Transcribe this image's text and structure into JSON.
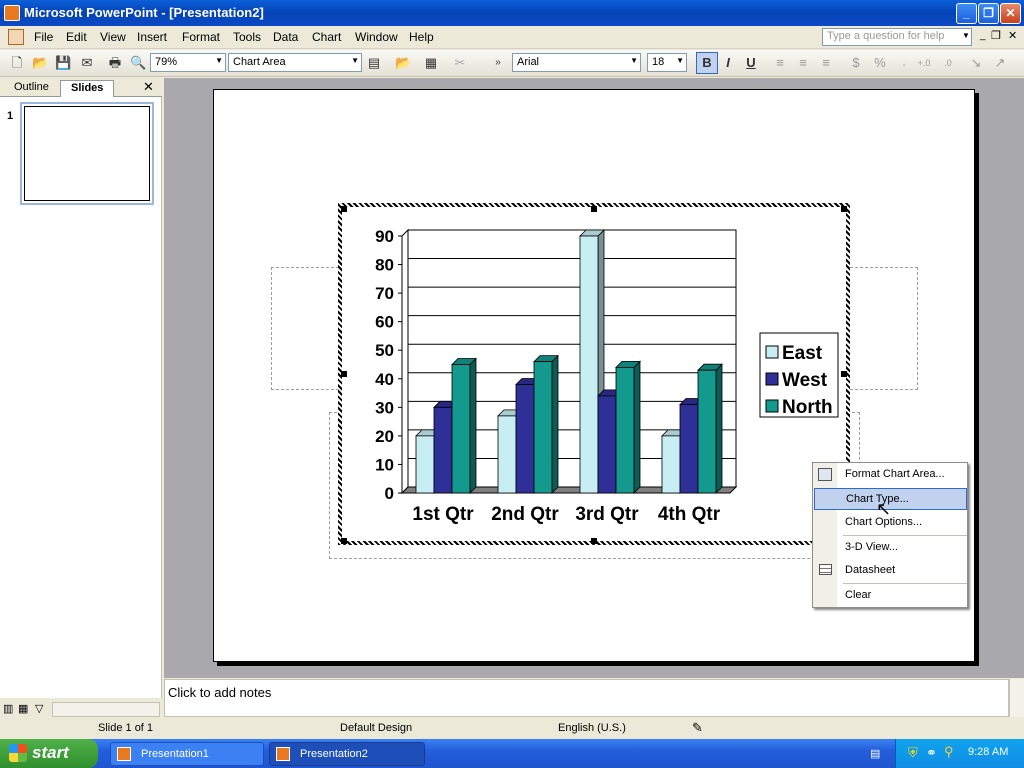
{
  "window": {
    "title": "Microsoft PowerPoint - [Presentation2]"
  },
  "menu": {
    "items": [
      "File",
      "Edit",
      "View",
      "Insert",
      "Format",
      "Tools",
      "Data",
      "Chart",
      "Window",
      "Help"
    ],
    "help_placeholder": "Type a question for help"
  },
  "toolbar": {
    "zoom": "79%",
    "chart_object": "Chart Area",
    "font": "Arial",
    "font_size": "18",
    "bold": "B",
    "italic": "I",
    "underline": "U"
  },
  "left_pane": {
    "tabs": [
      "Outline",
      "Slides"
    ],
    "active_tab": "Slides",
    "slide_number": "1",
    "close_glyph": "✕"
  },
  "chart_data": {
    "type": "bar",
    "categories": [
      "1st Qtr",
      "2nd Qtr",
      "3rd Qtr",
      "4th Qtr"
    ],
    "series": [
      {
        "name": "East",
        "color": "#c7eef2",
        "values": [
          20,
          27,
          90,
          20
        ]
      },
      {
        "name": "West",
        "color": "#2f2f98",
        "values": [
          30,
          38,
          34,
          31
        ]
      },
      {
        "name": "North",
        "color": "#14998f",
        "values": [
          45,
          46,
          44,
          43
        ]
      }
    ],
    "ylim": [
      0,
      90
    ],
    "yticks": [
      "0",
      "10",
      "20",
      "30",
      "40",
      "50",
      "60",
      "70",
      "80",
      "90"
    ],
    "grid": true,
    "legend": "right",
    "style": "3-D column"
  },
  "context_menu": {
    "items": [
      "Format Chart Area...",
      "Chart Type...",
      "Chart Options...",
      "3-D View...",
      "Datasheet",
      "Clear"
    ],
    "highlighted": "Chart Type..."
  },
  "notes": {
    "placeholder": "Click to add notes"
  },
  "status": {
    "slide": "Slide 1 of 1",
    "design": "Default Design",
    "language": "English (U.S.)"
  },
  "taskbar": {
    "start": "start",
    "tasks": [
      "Presentation1",
      "Presentation2"
    ],
    "clock": "9:28 AM"
  }
}
